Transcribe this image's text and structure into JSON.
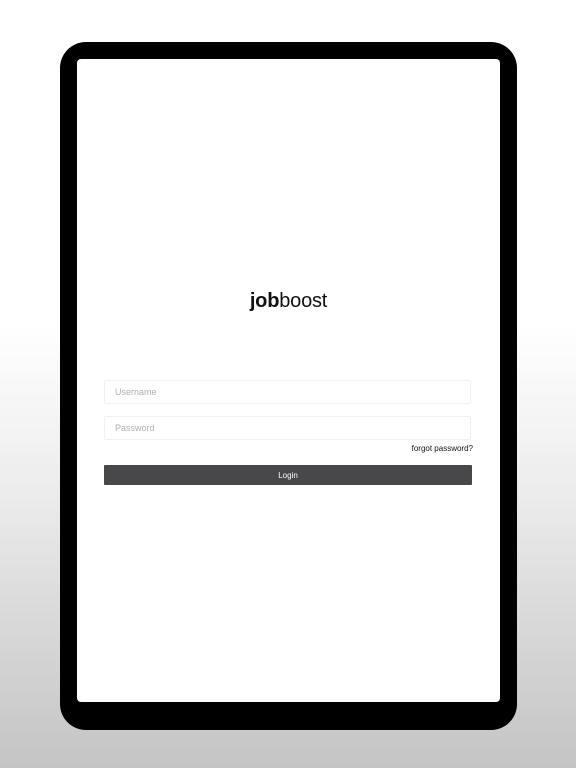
{
  "app": {
    "logo_bold": "job",
    "logo_light": "boost"
  },
  "login_form": {
    "username_placeholder": "Username",
    "password_placeholder": "Password",
    "username_value": "",
    "password_value": "",
    "forgot_password_label": "forgot password?",
    "login_button_label": "Login"
  },
  "colors": {
    "device_frame": "#000000",
    "screen_background": "#ffffff",
    "button_background": "#48474a",
    "button_text": "#ffffff",
    "input_border": "#f1f1f3",
    "placeholder_text": "#b0b0b6"
  }
}
